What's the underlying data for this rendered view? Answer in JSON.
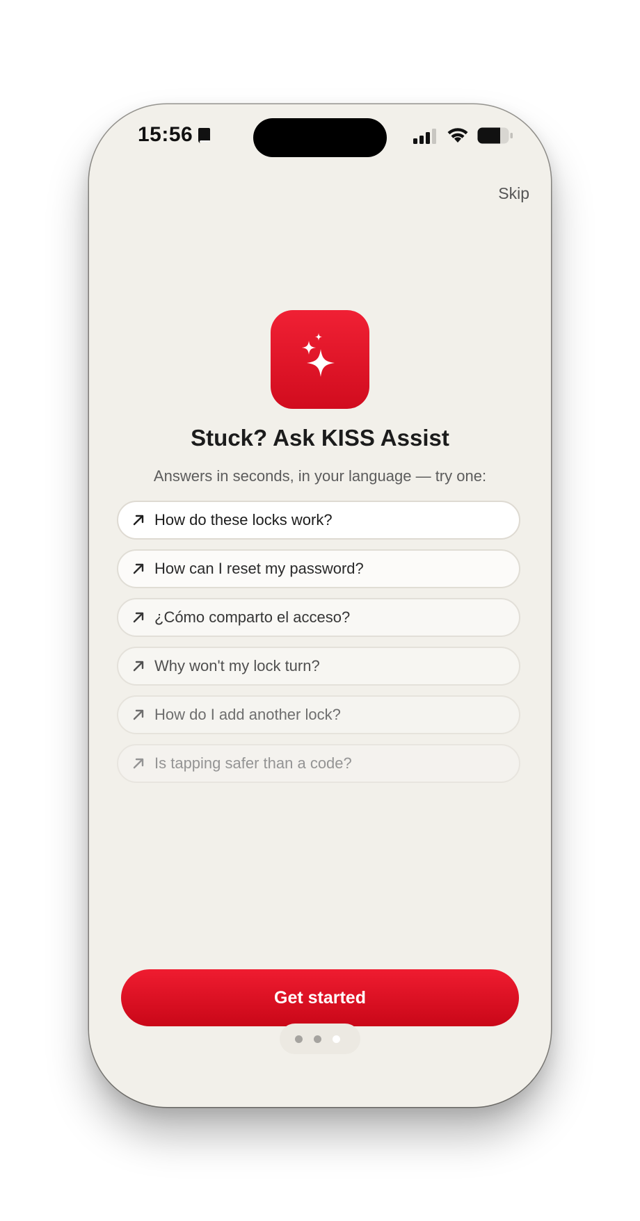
{
  "status_bar": {
    "time": "15:56",
    "icons": [
      "book-icon",
      "cellular-signal-icon",
      "wifi-icon",
      "battery-icon"
    ]
  },
  "header": {
    "skip_label": "Skip"
  },
  "hero": {
    "icon": "sparkles-icon",
    "title": "Stuck? Ask KISS Assist",
    "subtitle": "Answers in seconds, in your language — try one:"
  },
  "suggestions": [
    {
      "label": "How do these locks work?"
    },
    {
      "label": "How can I reset my password?"
    },
    {
      "label": "¿Cómo comparto el acceso?"
    },
    {
      "label": "Why won't my lock turn?"
    },
    {
      "label": "How do I add another lock?"
    },
    {
      "label": "Is tapping safer than a code?"
    }
  ],
  "cta": {
    "label": "Get started"
  },
  "pager": {
    "total": 3,
    "active_index": 2
  },
  "colors": {
    "accent": "#e3142a",
    "background": "#f2f0ea",
    "text": "#1c1c1c"
  }
}
